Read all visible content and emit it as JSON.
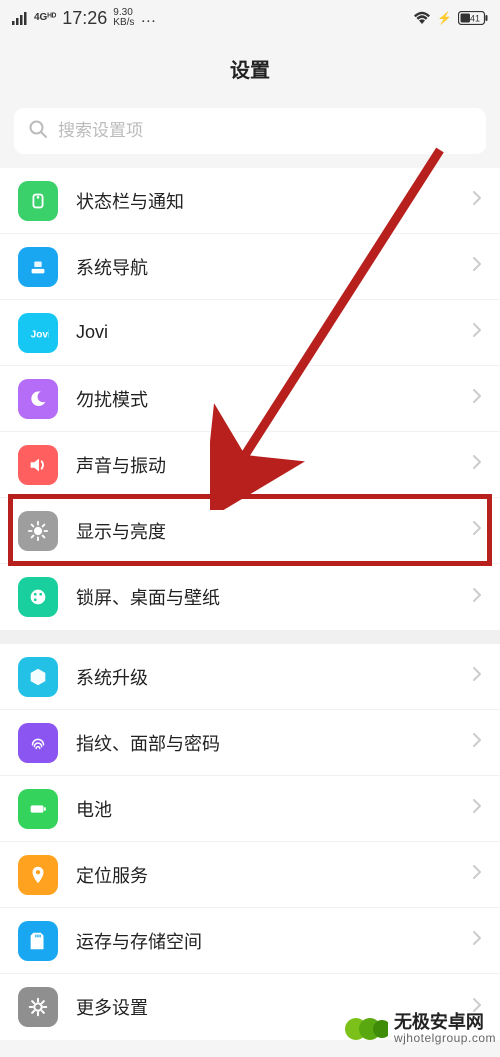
{
  "status": {
    "net_top": "4Gᴴᴰ",
    "time": "17:26",
    "speed_top": "9.30",
    "speed_unit": "KB/s",
    "dots": "…",
    "battery": "41"
  },
  "header": {
    "title": "设置"
  },
  "search": {
    "placeholder": "搜索设置项"
  },
  "groups": [
    {
      "items": [
        {
          "id": "statusbar",
          "label": "状态栏与通知",
          "color": "#3ad06a"
        },
        {
          "id": "sysnav",
          "label": "系统导航",
          "color": "#1aa7f2"
        },
        {
          "id": "jovi",
          "label": "Jovi",
          "color": "#16c7f4"
        },
        {
          "id": "dnd",
          "label": "勿扰模式",
          "color": "#b56df7"
        },
        {
          "id": "sound",
          "label": "声音与振动",
          "color": "#ff5f5f"
        },
        {
          "id": "display",
          "label": "显示与亮度",
          "color": "#9e9e9e"
        },
        {
          "id": "lockscreen",
          "label": "锁屏、桌面与壁纸",
          "color": "#18cf9d"
        }
      ]
    },
    {
      "items": [
        {
          "id": "sysupgrade",
          "label": "系统升级",
          "color": "#23c1e6"
        },
        {
          "id": "biometrics",
          "label": "指纹、面部与密码",
          "color": "#8a55f0"
        },
        {
          "id": "battery",
          "label": "电池",
          "color": "#34d45c"
        },
        {
          "id": "location",
          "label": "定位服务",
          "color": "#ffa21f"
        },
        {
          "id": "storage",
          "label": "运存与存储空间",
          "color": "#1aa7f2"
        },
        {
          "id": "moresettings",
          "label": "更多设置",
          "color": "#8f8f8f"
        }
      ]
    }
  ],
  "icons": {
    "statusbar": "notification",
    "sysnav": "nav",
    "jovi": "jovi",
    "dnd": "moon",
    "sound": "volume",
    "display": "brightness",
    "lockscreen": "palette",
    "sysupgrade": "cube",
    "biometrics": "fingerprint",
    "battery": "battery",
    "location": "pin",
    "storage": "sd",
    "moresettings": "gear"
  },
  "watermark": {
    "title": "无极安卓网",
    "url": "wjhotelgroup.com"
  }
}
